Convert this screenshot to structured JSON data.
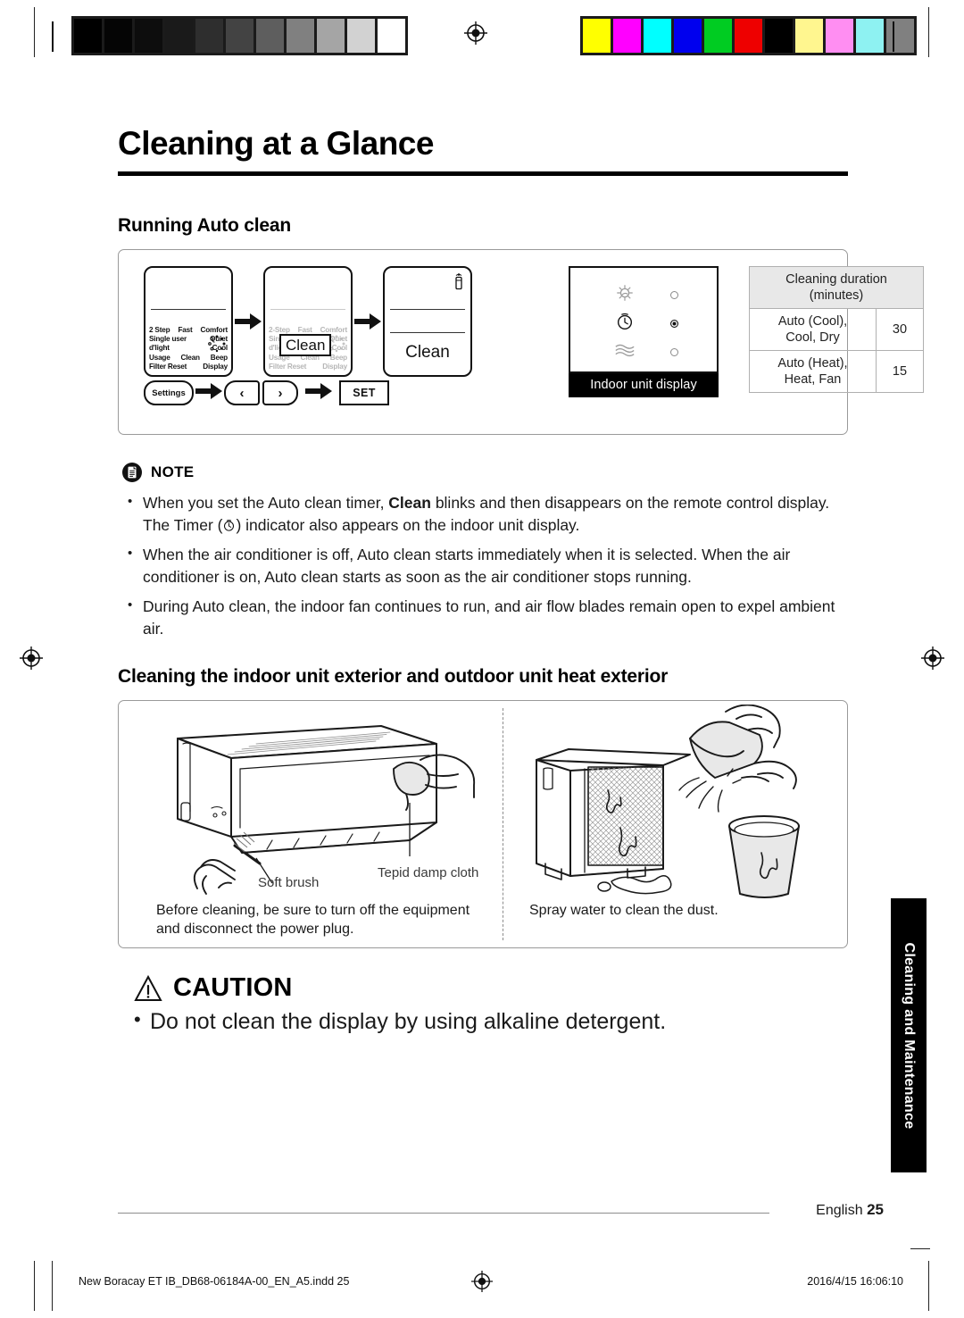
{
  "calibration": {
    "grayscale": [
      "#000000",
      "#050505",
      "#0d0d0d",
      "#1a1a1a",
      "#2e2e2e",
      "#434343",
      "#5e5e5e",
      "#808080",
      "#a5a5a5",
      "#d2d2d2",
      "#ffffff"
    ],
    "colors": [
      "#ffff00",
      "#ff00ff",
      "#00ffff",
      "#0000ee",
      "#00cc22",
      "#ee0000",
      "#000000",
      "#fff68f",
      "#ff8ef2",
      "#8ef2f2",
      "#808080"
    ]
  },
  "page": {
    "title": "Cleaning at a Glance",
    "section_heading": "Running Auto clean",
    "second_heading": "Cleaning the indoor unit exterior and outdoor unit heat exterior",
    "side_tab": "Cleaning and Maintenance",
    "page_label": "English",
    "page_number": "25"
  },
  "remote": {
    "lcd_lines": [
      [
        "2 Step",
        "Fast",
        "Comfort"
      ],
      [
        "Single user",
        "Quiet"
      ],
      [
        "d'light",
        "Cool"
      ],
      [
        "Usage",
        "Clean",
        "Beep"
      ],
      [
        "Filter Reset",
        "Display"
      ]
    ],
    "lcd_lines_dim": [
      [
        "2-Step",
        "Fast",
        "Comfort"
      ],
      [
        "Single user",
        "Quiet"
      ],
      [
        "d'light",
        "Cool"
      ],
      [
        "Usage",
        "Clean",
        "Beep"
      ],
      [
        "Filter Reset",
        "Display"
      ]
    ],
    "callout": "Clean",
    "result_text": "Clean",
    "buttons": {
      "settings": "Settings",
      "prev": "‹",
      "next": "›",
      "set": "SET"
    }
  },
  "indoor_display": {
    "label": "Indoor unit display",
    "indicators": [
      {
        "icon": "eco-sun-icon",
        "state": "off"
      },
      {
        "icon": "timer-clock-icon",
        "state": "on"
      },
      {
        "icon": "airflow-wave-icon",
        "state": "off"
      }
    ]
  },
  "duration_table": {
    "header": "Cleaning duration (minutes)",
    "header_line1": "Cleaning duration",
    "header_line2": "(minutes)",
    "rows": [
      {
        "mode_line1": "Auto (Cool),",
        "mode_line2": "Cool, Dry",
        "minutes": "30"
      },
      {
        "mode_line1": "Auto (Heat),",
        "mode_line2": "Heat, Fan",
        "minutes": "15"
      }
    ]
  },
  "note": {
    "title": "NOTE",
    "bullets": [
      {
        "part1": "When you set the Auto clean timer, ",
        "bold": "Clean",
        "part2": " blinks and then disappears on the remote control display. The Timer (",
        "part3": ") indicator also appears on the indoor unit display."
      },
      {
        "text": "When the air conditioner is off, Auto clean starts immediately when it is selected. When the air conditioner is on, Auto clean starts as soon as the air conditioner stops running."
      },
      {
        "text": "During Auto clean, the indoor fan continues to run, and air flow blades remain open to expel ambient air."
      }
    ]
  },
  "illustrations": {
    "indoor": {
      "label_cloth": "Tepid damp cloth",
      "label_brush": "Soft brush",
      "caption_line1": "Before cleaning, be sure to turn off the equipment",
      "caption_line2": "and disconnect the power plug."
    },
    "outdoor": {
      "caption": "Spray water to clean the dust."
    }
  },
  "caution": {
    "title": "CAUTION",
    "text": "Do not clean the display by using alkaline detergent."
  },
  "footer": {
    "file": "New Boracay ET IB_DB68-06184A-00_EN_A5.indd   25",
    "timestamp": "2016/4/15   16:06:10"
  }
}
